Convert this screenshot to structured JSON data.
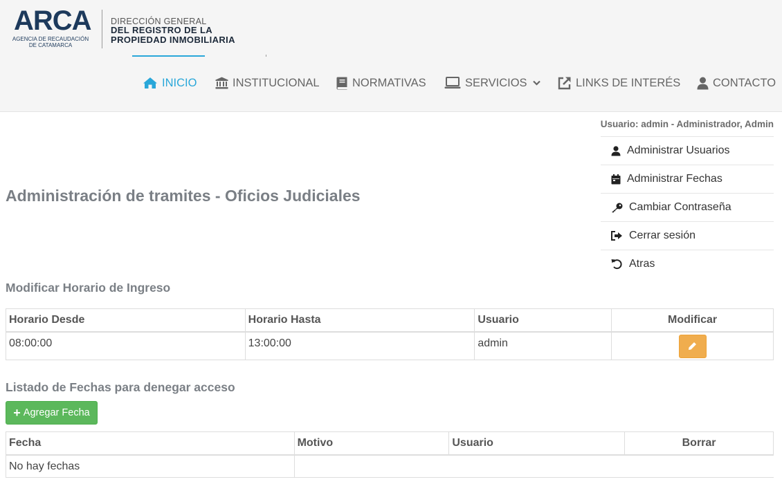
{
  "brand": {
    "logo_text": "ARCA",
    "logo_sub_1": "AGENCIA DE RECAUDACIÓN",
    "logo_sub_2": "DE CATAMARCA",
    "dg": "DIRECCIÓN GENERAL",
    "reg_1": "DEL REGISTRO DE LA",
    "reg_2": "PROPIEDAD INMOBILIARIA"
  },
  "nav": {
    "inicio": "INICIO",
    "institucional": "INSTITUCIONAL",
    "normativas": "NORMATIVAS",
    "servicios": "SERVICIOS",
    "links": "LINKS DE INTERÉS",
    "contacto": "CONTACTO"
  },
  "user": {
    "label": "Usuario: admin - Administrador, Admin",
    "menu": [
      {
        "label": "Administrar Usuarios",
        "icon": "user-icon"
      },
      {
        "label": "Administrar Fechas",
        "icon": "calendar-icon"
      },
      {
        "label": "Cambiar Contraseña",
        "icon": "key-icon"
      },
      {
        "label": "Cerrar sesión",
        "icon": "sign-out-icon"
      },
      {
        "label": "Atras",
        "icon": "undo-icon"
      }
    ]
  },
  "page_title": "Administración de tramites - Oficios Judiciales",
  "horario": {
    "title": "Modificar Horario de Ingreso",
    "headers": [
      "Horario Desde",
      "Horario Hasta",
      "Usuario",
      "Modificar"
    ],
    "row": {
      "desde": "08:00:00",
      "hasta": "13:00:00",
      "usuario": "admin"
    }
  },
  "fechas": {
    "title": "Listado de Fechas para denegar acceso",
    "add_label": "Agregar Fecha",
    "headers": [
      "Fecha",
      "Motivo",
      "Usuario",
      "Borrar"
    ],
    "empty": "No hay fechas"
  },
  "colors": {
    "accent": "#29a7d9",
    "warning": "#f0ad4e",
    "success": "#5cb85c",
    "brand_dark": "#1d3a5c"
  }
}
